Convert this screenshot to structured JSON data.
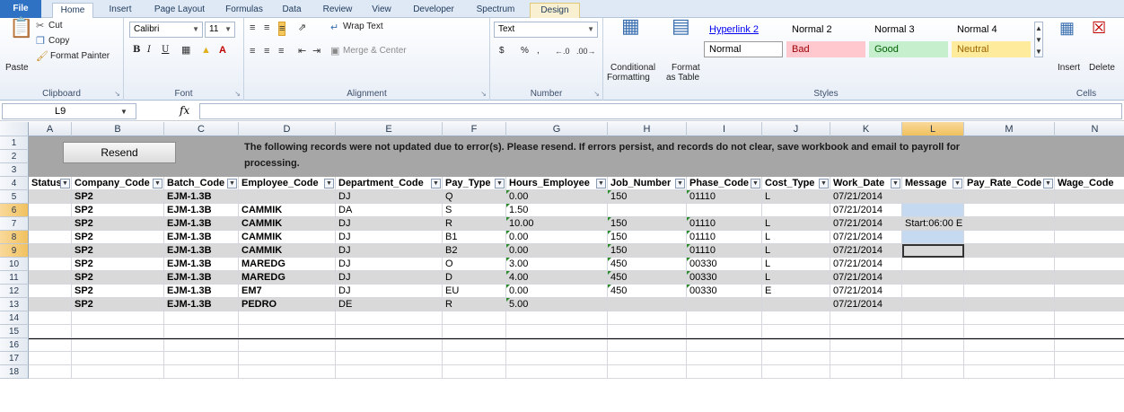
{
  "ribbon_tabs": [
    "File",
    "Home",
    "Insert",
    "Page Layout",
    "Formulas",
    "Data",
    "Review",
    "View",
    "Developer",
    "Spectrum",
    "Design"
  ],
  "clipboard": {
    "paste": "Paste",
    "cut": "Cut",
    "copy": "Copy",
    "format_painter": "Format Painter",
    "label": "Clipboard"
  },
  "font": {
    "name": "Calibri",
    "size": "11",
    "label": "Font",
    "bold": "B",
    "italic": "I",
    "underline": "U"
  },
  "alignment": {
    "wrap_text": "Wrap Text",
    "merge_center": "Merge & Center",
    "label": "Alignment"
  },
  "number": {
    "format": "Text",
    "currency": "$",
    "percent": "%",
    "comma": ",",
    "label": "Number"
  },
  "styles_group": {
    "conditional": "Conditional",
    "conditional2": "Formatting",
    "format_as": "Format",
    "format_as2": "as Table",
    "items": [
      "Hyperlink 2",
      "Normal 2",
      "Normal 3",
      "Normal 4",
      "Normal",
      "Bad",
      "Good",
      "Neutral"
    ],
    "label": "Styles"
  },
  "cells_group": {
    "insert": "Insert",
    "delete": "Delete",
    "label": "Cells"
  },
  "formula_bar": {
    "name_box": "L9",
    "fx": "fx",
    "value": ""
  },
  "columns": [
    "A",
    "B",
    "C",
    "D",
    "E",
    "F",
    "G",
    "H",
    "I",
    "J",
    "K",
    "L",
    "M",
    "N"
  ],
  "row_numbers": [
    "1",
    "2",
    "3",
    "4",
    "5",
    "6",
    "7",
    "8",
    "9",
    "10",
    "11",
    "12",
    "13",
    "14",
    "15",
    "16",
    "17",
    "18"
  ],
  "resend_label": "Resend",
  "banner_message": "The following records were not updated due to error(s). Please resend. If errors persist, and records do not clear, save workbook and email to payroll for processing.",
  "table_headers": [
    "Status",
    "Company_Code",
    "Batch_Code",
    "Employee_Code",
    "Department_Code",
    "Pay_Type",
    "Hours_Employee",
    "Job_Number",
    "Phase_Code",
    "Cost_Type",
    "Work_Date",
    "Message",
    "Pay_Rate_Code",
    "Wage_Code"
  ],
  "table_rows": [
    [
      "",
      "SP2",
      "EJM-1.3B",
      "",
      "DJ",
      "Q",
      "0.00",
      "150",
      "01110",
      "L",
      "07/21/2014",
      "",
      "",
      ""
    ],
    [
      "",
      "SP2",
      "EJM-1.3B",
      "CAMMIK",
      "DA",
      "S",
      "1.50",
      "",
      "",
      "",
      "07/21/2014",
      "",
      "",
      ""
    ],
    [
      "",
      "SP2",
      "EJM-1.3B",
      "CAMMIK",
      "DJ",
      "R",
      "10.00",
      "150",
      "01110",
      "L",
      "07/21/2014",
      "Start:06:00 E",
      "",
      ""
    ],
    [
      "",
      "SP2",
      "EJM-1.3B",
      "CAMMIK",
      "DJ",
      "B1",
      "0.00",
      "150",
      "01110",
      "L",
      "07/21/2014",
      "",
      "",
      ""
    ],
    [
      "",
      "SP2",
      "EJM-1.3B",
      "CAMMIK",
      "DJ",
      "B2",
      "0.00",
      "150",
      "01110",
      "L",
      "07/21/2014",
      "",
      "",
      ""
    ],
    [
      "",
      "SP2",
      "EJM-1.3B",
      "MAREDG",
      "DJ",
      "O",
      "3.00",
      "450",
      "00330",
      "L",
      "07/21/2014",
      "",
      "",
      ""
    ],
    [
      "",
      "SP2",
      "EJM-1.3B",
      "MAREDG",
      "DJ",
      "D",
      "4.00",
      "450",
      "00330",
      "L",
      "07/21/2014",
      "",
      "",
      ""
    ],
    [
      "",
      "SP2",
      "EJM-1.3B",
      "EM7",
      "DJ",
      "EU",
      "0.00",
      "450",
      "00330",
      "E",
      "07/21/2014",
      "",
      "",
      ""
    ],
    [
      "",
      "SP2",
      "EJM-1.3B",
      "PEDRO",
      "DE",
      "R",
      "5.00",
      "",
      "",
      "",
      "07/21/2014",
      "",
      "",
      ""
    ]
  ],
  "colors": {
    "banner": "#a6a6a6",
    "band": "#d9d9d9",
    "selection": "#c5d9f1",
    "header_highlight": "#f1c15f"
  }
}
